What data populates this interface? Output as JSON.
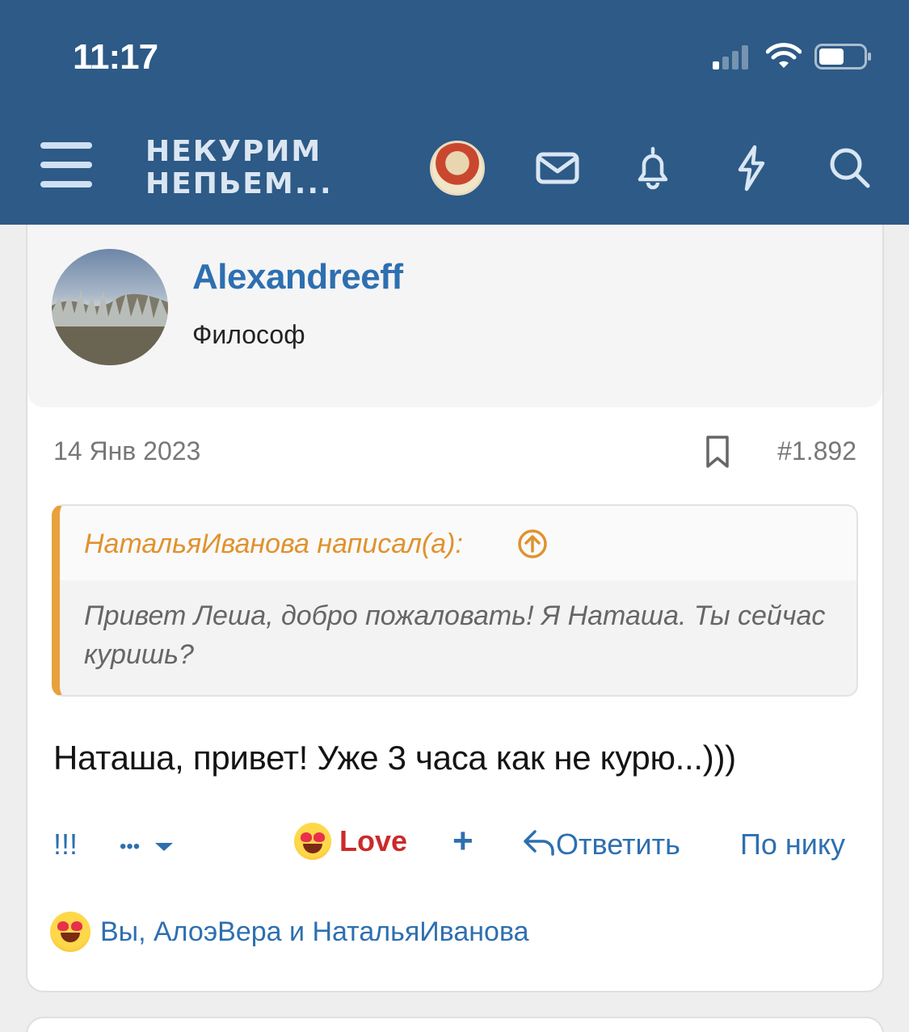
{
  "status_bar": {
    "time": "11:17"
  },
  "header": {
    "logo_line1": "НЕКУРИМ",
    "logo_line2": "НЕПЬЕМ..."
  },
  "post": {
    "author": "Alexandreeff",
    "author_title": "Философ",
    "date": "14 Янв 2023",
    "number": "#1.892",
    "quote": {
      "author_line": "НатальяИванова написал(а):",
      "text": "Привет Леша, добро пожаловать! Я Наташа. Ты сейчас куришь?"
    },
    "message": "Наташа, привет! Уже 3 часа как не курю...)))",
    "actions": {
      "exclaim": "!!!",
      "more": "•••",
      "love": "Love",
      "add": "+",
      "reply": "Ответить",
      "by_nick": "По нику"
    },
    "reactions_text": "Вы, АлоэВера и НатальяИванова"
  },
  "colors": {
    "header_bg": "#2d5a86",
    "link": "#2e6fb0",
    "quote_accent": "#e8a13c",
    "love": "#cc2a2a"
  }
}
